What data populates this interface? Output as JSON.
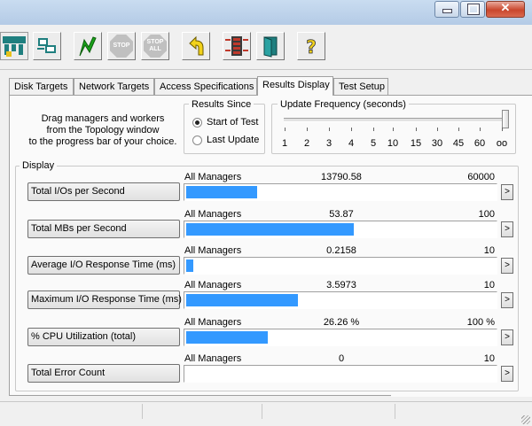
{
  "window": {
    "controls": [
      "minimize",
      "maximize",
      "close"
    ]
  },
  "toolbar": [
    {
      "name": "topology-button",
      "icon": "network-topology-icon"
    },
    {
      "name": "new-manager-button",
      "icon": "computers-icon"
    },
    {
      "name": "start-button",
      "icon": "green-flag-icon"
    },
    {
      "name": "stop-button",
      "icon": "stop-sign-icon",
      "text": "STOP"
    },
    {
      "name": "stop-all-button",
      "icon": "stop-all-sign-icon",
      "text": "STOP",
      "text2": "ALL"
    },
    {
      "name": "reset-button",
      "icon": "yellow-arrow-icon"
    },
    {
      "name": "disconnect-button",
      "icon": "switches-icon"
    },
    {
      "name": "exit-button",
      "icon": "door-exit-icon"
    },
    {
      "name": "help-button",
      "icon": "question-mark-icon"
    }
  ],
  "tabs": [
    "Disk Targets",
    "Network Targets",
    "Access Specifications",
    "Results Display",
    "Test Setup"
  ],
  "active_tab": "Results Display",
  "hint_lines": [
    "Drag managers and workers",
    "from the Topology window",
    "to the progress bar of your choice."
  ],
  "results_since": {
    "title": "Results Since",
    "options": [
      "Start of Test",
      "Last Update"
    ],
    "selected": "Start of Test"
  },
  "update_frequency": {
    "title": "Update Frequency (seconds)",
    "ticks": [
      "1",
      "2",
      "3",
      "4",
      "5",
      "10",
      "15",
      "30",
      "45",
      "60",
      "oo"
    ],
    "selected": "oo"
  },
  "display": {
    "title": "Display",
    "rows": [
      {
        "button": "Total I/Os per Second",
        "manager": "All Managers",
        "value": "13790.58",
        "max": "60000",
        "fill": 0.2298
      },
      {
        "button": "Total MBs per Second",
        "manager": "All Managers",
        "value": "53.87",
        "max": "100",
        "fill": 0.5387
      },
      {
        "button": "Average I/O Response Time (ms)",
        "manager": "All Managers",
        "value": "0.2158",
        "max": "10",
        "fill": 0.0216
      },
      {
        "button": "Maximum I/O Response Time (ms)",
        "manager": "All Managers",
        "value": "3.5973",
        "max": "10",
        "fill": 0.3597
      },
      {
        "button": "% CPU Utilization (total)",
        "manager": "All Managers",
        "value": "26.26 %",
        "max": "100 %",
        "fill": 0.2626
      },
      {
        "button": "Total Error Count",
        "manager": "All Managers",
        "value": "0",
        "max": "10",
        "fill": 0
      }
    ],
    "arrow_label": ">"
  },
  "colors": {
    "bar": "#3399ff",
    "title_bar": "#b9cfe8",
    "close": "#c9462c"
  }
}
